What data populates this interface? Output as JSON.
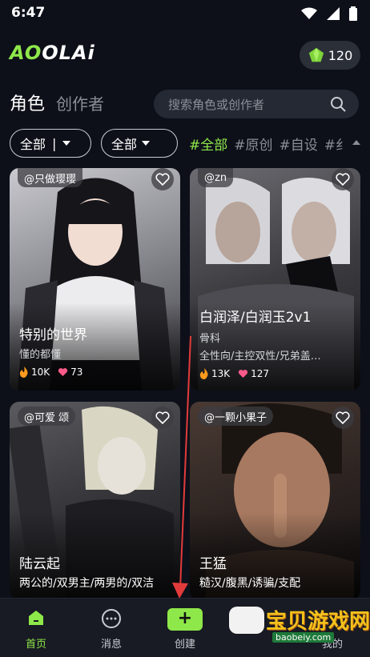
{
  "status": {
    "time": "6:47"
  },
  "header": {
    "logo_prefix": "AO",
    "logo_text": "OLAi",
    "coins": "120"
  },
  "tabs": {
    "active": "角色",
    "other": "创作者"
  },
  "search": {
    "placeholder": "搜索角色或创作者"
  },
  "filters": {
    "dropdown1": "全部",
    "dropdown2": "全部",
    "tags": [
      "#全部",
      "#原创",
      "#自设",
      "#纟"
    ]
  },
  "cards": [
    {
      "author": "@只做璎璎",
      "name": "特别的世界",
      "sub": "懂的都懂",
      "heat": "10K",
      "likes": "73"
    },
    {
      "author": "@zn",
      "name": "白润泽/白润玉2v1",
      "sub": "骨科",
      "sub2": "全性向/主控双性/兄弟盖…",
      "heat": "13K",
      "likes": "127"
    },
    {
      "author": "@可爱 颂",
      "name": "陆云起",
      "sub": "两公的/双男主/两男的/双洁"
    },
    {
      "author": "@一颗小果子",
      "name": "王猛",
      "sub": "糙汉/腹黑/诱骗/支配"
    }
  ],
  "nav": {
    "home": "首页",
    "messages": "消息",
    "create": "创建",
    "mine": "我的"
  },
  "watermark": {
    "title": "宝贝游戏网",
    "url": "baobeiy.com"
  },
  "colors": {
    "accent": "#8fe84a",
    "background": "#0d1019"
  }
}
